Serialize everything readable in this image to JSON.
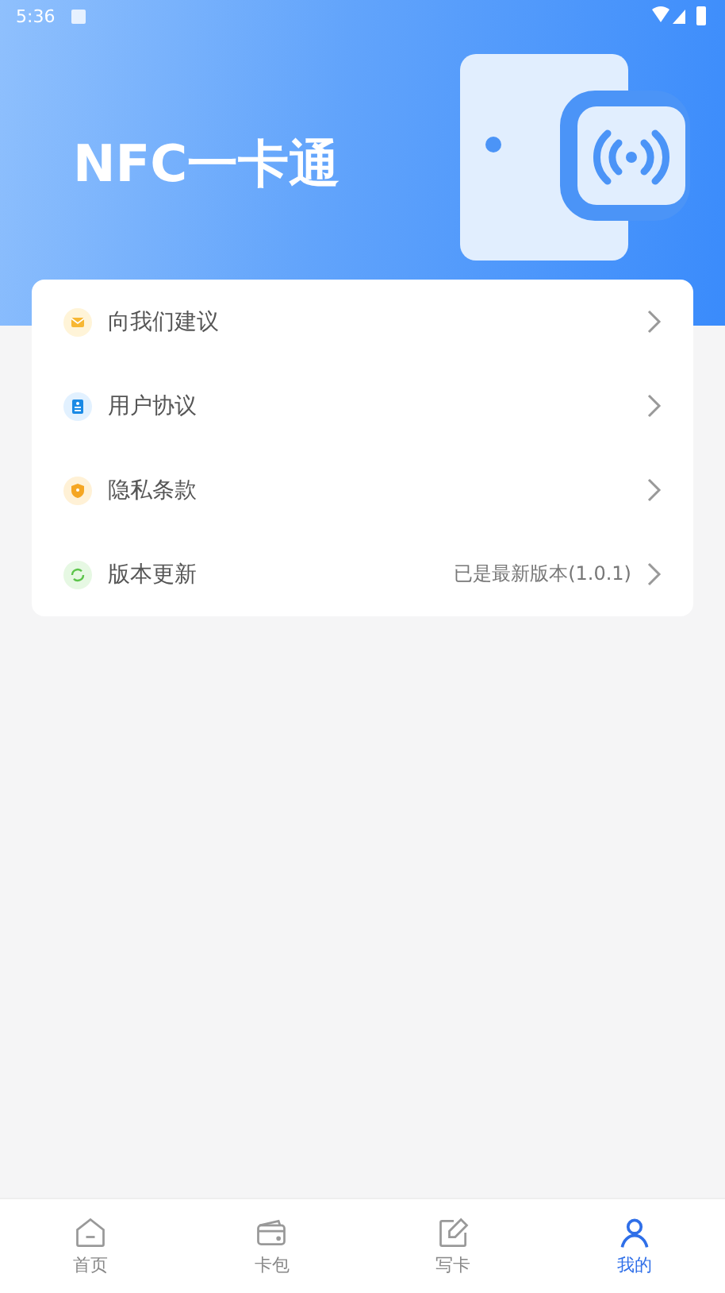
{
  "status_bar": {
    "time": "5:36"
  },
  "header": {
    "title": "NFC一卡通"
  },
  "menu": [
    {
      "kind": "mail",
      "label": "向我们建议"
    },
    {
      "kind": "document",
      "label": "用户协议"
    },
    {
      "kind": "shield",
      "label": "隐私条款"
    },
    {
      "kind": "refresh",
      "label": "版本更新",
      "value": "已是最新版本(1.0.1)"
    }
  ],
  "tabs": [
    {
      "kind": "home",
      "label": "首页",
      "selected": false
    },
    {
      "kind": "wallet",
      "label": "卡包",
      "selected": false
    },
    {
      "kind": "edit",
      "label": "写卡",
      "selected": false
    },
    {
      "kind": "user",
      "label": "我的",
      "selected": true
    }
  ]
}
